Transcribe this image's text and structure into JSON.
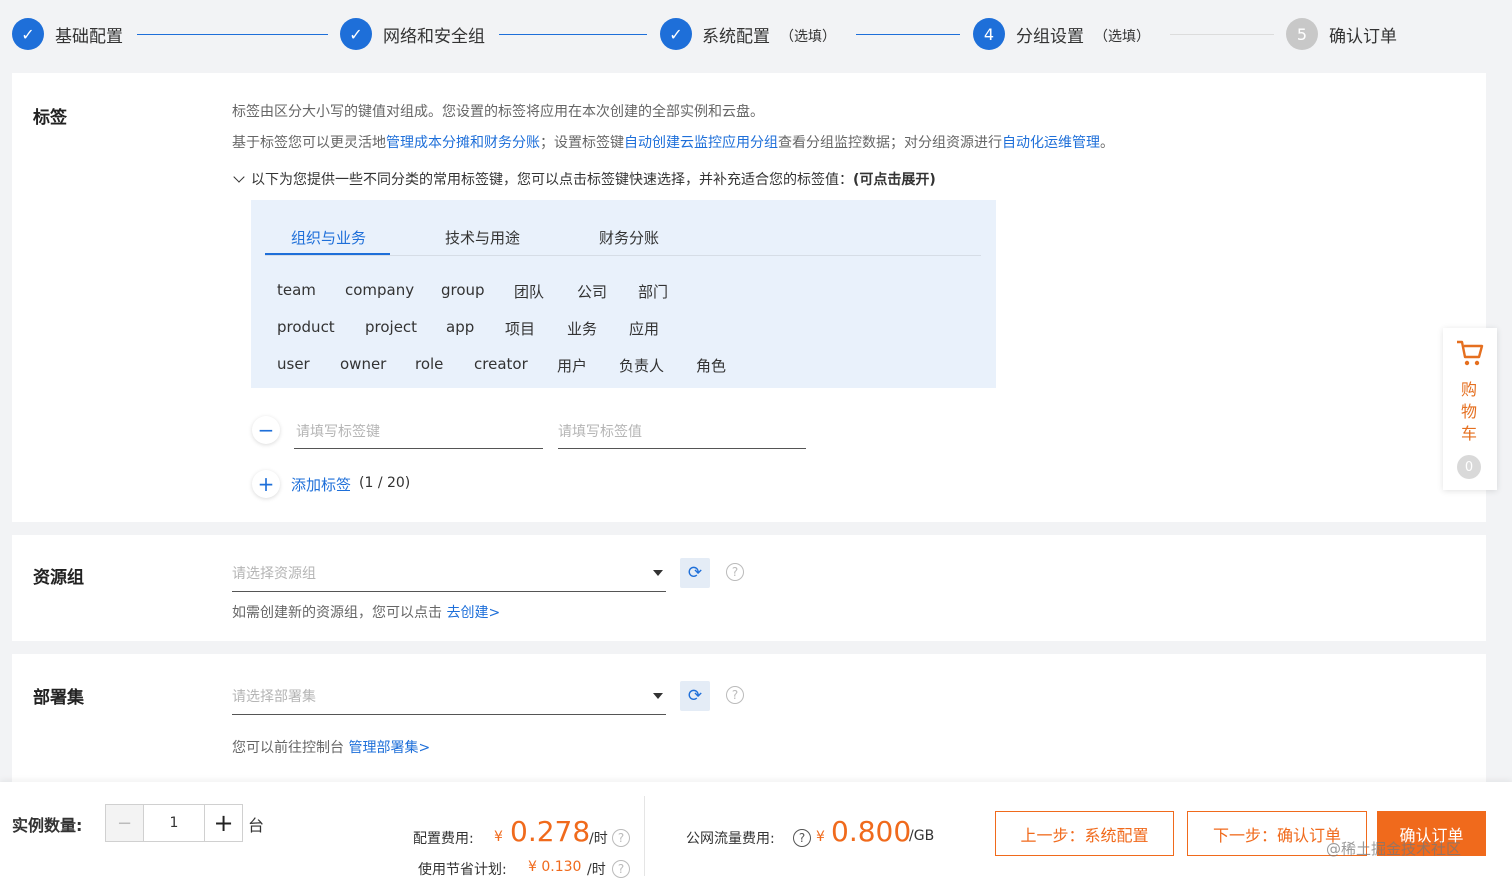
{
  "steps": [
    {
      "label": "基础配置",
      "optional": "",
      "number": "",
      "state": "done"
    },
    {
      "label": "网络和安全组",
      "optional": "",
      "number": "",
      "state": "done"
    },
    {
      "label": "系统配置",
      "optional": "（选填）",
      "number": "",
      "state": "done"
    },
    {
      "label": "分组设置",
      "optional": "（选填）",
      "number": "4",
      "state": "active"
    },
    {
      "label": "确认订单",
      "optional": "",
      "number": "5",
      "state": "todo"
    }
  ],
  "tags": {
    "title": "标签",
    "desc1": "标签由区分大小写的键值对组成。您设置的标签将应用在本次创建的全部实例和云盘。",
    "desc2_pre": "基于标签您可以更灵活地",
    "desc2_link1": "管理成本分摊和财务分账",
    "desc2_mid1": "；设置标签键",
    "desc2_link2": "自动创建云监控应用分组",
    "desc2_mid2": "查看分组监控数据；对分组资源进行",
    "desc2_link3": "自动化运维管理",
    "desc2_end": "。",
    "expand_text": "以下为您提供一些不同分类的常用标签键，您可以点击标签键快速选择，并补充适合您的标签值：",
    "expand_bold": "(可点击展开)",
    "tabs": [
      "组织与业务",
      "技术与用途",
      "财务分账"
    ],
    "rows": [
      [
        "team",
        "company",
        "group",
        "团队",
        "公司",
        "部门"
      ],
      [
        "product",
        "project",
        "app",
        "项目",
        "业务",
        "应用"
      ],
      [
        "user",
        "owner",
        "role",
        "creator",
        "用户",
        "负责人",
        "角色"
      ]
    ],
    "key_placeholder": "请填写标签键",
    "value_placeholder": "请填写标签值",
    "add_label": "添加标签",
    "add_count": "(1 / 20)"
  },
  "resource_group": {
    "title": "资源组",
    "placeholder": "请选择资源组",
    "hint": "如需创建新的资源组，您可以点击",
    "hint_link": "去创建>"
  },
  "deployment_set": {
    "title": "部署集",
    "placeholder": "请选择部署集",
    "hint": "您可以前往控制台",
    "hint_link": "管理部署集>"
  },
  "cart": {
    "chars": [
      "购",
      "物",
      "车"
    ],
    "count": "0"
  },
  "footer": {
    "qty_label": "实例数量:",
    "qty_value": "1",
    "qty_unit": "台",
    "config_fee_label": "配置费用:",
    "config_fee_currency": "¥",
    "config_fee_value": "0.278",
    "config_fee_unit": "/时",
    "saving_label": "使用节省计划:",
    "saving_value": "¥ 0.130",
    "saving_unit": "/时",
    "traffic_label": "公网流量费用:",
    "traffic_currency": "¥",
    "traffic_value": "0.800",
    "traffic_unit": "/GB",
    "prev_btn": "上一步：系统配置",
    "next_btn": "下一步：确认订单",
    "confirm_btn": "确认订单",
    "watermark": "@稀土掘金技术社区"
  },
  "colors": {
    "accent": "#1e6fd9",
    "orange": "#f06a1c"
  }
}
